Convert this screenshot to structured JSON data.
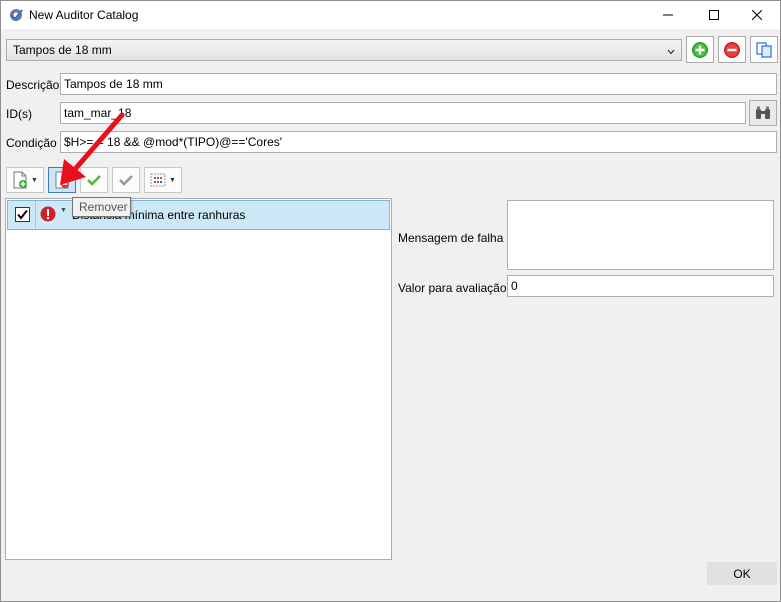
{
  "window": {
    "title": "New Auditor Catalog"
  },
  "catalog_select": {
    "value": "Tampos de 18 mm"
  },
  "form": {
    "descricao_label": "Descrição",
    "descricao_value": "Tampos de 18 mm",
    "ids_label": "ID(s)",
    "ids_value": "tam_mar_18",
    "condicao_label": "Condição",
    "condicao_value": "$H>= = 18 && @mod*(TIPO)@=='Cores'"
  },
  "rule_list": {
    "items": [
      {
        "checked": true,
        "status": "error",
        "label": "Distância mínima entre ranhuras"
      }
    ]
  },
  "tooltip": {
    "text": "Remover"
  },
  "details": {
    "mensagem_label": "Mensagem de falha",
    "mensagem_value": "",
    "valor_label": "Valor para avaliação",
    "valor_value": "0"
  },
  "footer": {
    "ok_label": "OK"
  },
  "colors": {
    "add": "#2e9f2e",
    "remove": "#e03030",
    "selection": "#cce8f6",
    "arrow": "#e8101c"
  }
}
